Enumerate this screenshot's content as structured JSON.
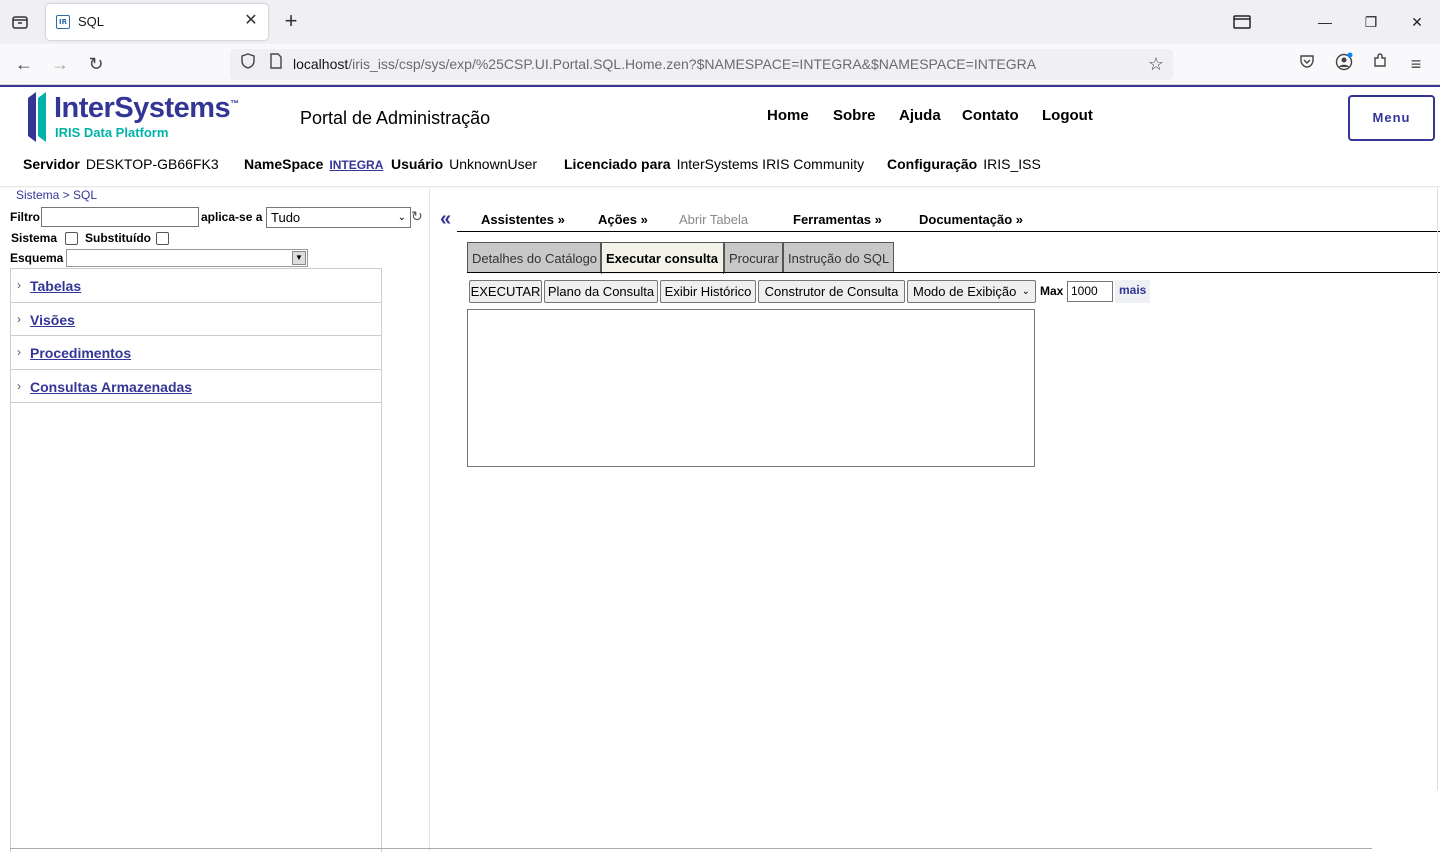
{
  "browser": {
    "tab_title": "SQL",
    "tab_favicon": "IR",
    "url_host": "localhost",
    "url_path": "/iris_iss/csp/sys/exp/%25CSP.UI.Portal.SQL.Home.zen?$NAMESPACE=INTEGRA&$NAMESPACE=INTEGRA",
    "icons": [
      "tab-list-icon",
      "close-icon",
      "new-tab-icon",
      "window-mode-icon",
      "minimize-icon",
      "restore-icon",
      "close-window-icon",
      "back-icon",
      "forward-icon",
      "reload-icon",
      "shield-icon",
      "page-icon",
      "star-icon",
      "pocket-icon",
      "account-icon",
      "extensions-icon",
      "menu-icon"
    ]
  },
  "header": {
    "logo_main": "InterSystems",
    "logo_tm": "™",
    "logo_sub": "IRIS Data Platform",
    "portal_title": "Portal de Administração",
    "nav": [
      "Home",
      "Sobre",
      "Ajuda",
      "Contato",
      "Logout"
    ],
    "menu_label": "Menu",
    "server_label": "Servidor",
    "server_value": "DESKTOP-GB66FK3",
    "namespace_label": "NameSpace",
    "namespace_value": "INTEGRA",
    "user_label": "Usuário",
    "user_value": "UnknownUser",
    "license_label": "Licenciado para",
    "license_value": "InterSystems IRIS Community",
    "config_label": "Configuração",
    "config_value": "IRIS_ISS"
  },
  "left": {
    "breadcrumb": "Sistema > SQL",
    "filter_label": "Filtro",
    "filter_value": "",
    "applies_label": "aplica-se a",
    "applies_value": "Tudo",
    "system_label": "Sistema",
    "replaced_label": "Substituído",
    "schema_label": "Esquema",
    "tree": [
      "Tabelas",
      "Visões",
      "Procedimentos",
      "Consultas Armazenadas"
    ]
  },
  "right": {
    "collapse_glyph": "«",
    "menu": [
      "Assistentes »",
      "Ações »",
      "Abrir Tabela",
      "Ferramentas »",
      "Documentação »"
    ],
    "tabs": [
      "Detalhes do Catálogo",
      "Executar consulta",
      "Procurar",
      "Instrução do SQL"
    ],
    "active_tab": "Executar consulta",
    "buttons": [
      "EXECUTAR",
      "Plano da Consulta",
      "Exibir Histórico",
      "Construtor de Consulta"
    ],
    "display_mode": "Modo de Exibição",
    "max_label": "Max",
    "max_value": "1000",
    "more_label": "mais",
    "query_text": ""
  },
  "colors": {
    "brand": "#333695",
    "teal": "#00b2a9"
  }
}
